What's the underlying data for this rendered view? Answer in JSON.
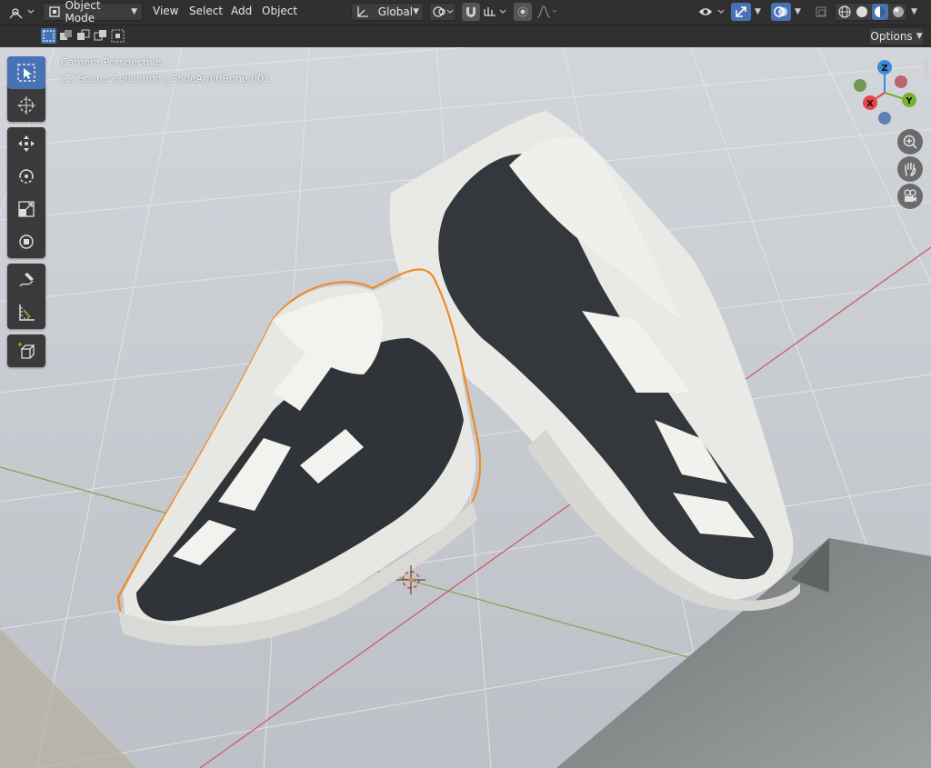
{
  "header": {
    "mode_label": "Object Mode",
    "menus": [
      "View",
      "Select",
      "Add",
      "Object"
    ],
    "transform_orientation": "Global",
    "options_label": "Options"
  },
  "viewport": {
    "camera_label": "Camera Perspective",
    "collection_label": "(1) Scene Collection | ShoeAmiriBone.001"
  },
  "gizmo": {
    "z_label": "Z",
    "y_label": "Y",
    "x_label": "X"
  },
  "colors": {
    "active_blue": "#4772b3",
    "selection_outline": "#f08a24",
    "axis_red": "#e8434c",
    "axis_green": "#77b22d",
    "axis_blue": "#3a8ad9"
  },
  "icons": {
    "toolbar": [
      "select-box-icon",
      "cursor-icon",
      "move-icon",
      "rotate-icon",
      "scale-icon",
      "transform-icon",
      "annotate-icon",
      "measure-icon",
      "add-cube-icon"
    ],
    "navigation": [
      "zoom-icon",
      "pan-hand-icon",
      "camera-view-icon"
    ]
  }
}
